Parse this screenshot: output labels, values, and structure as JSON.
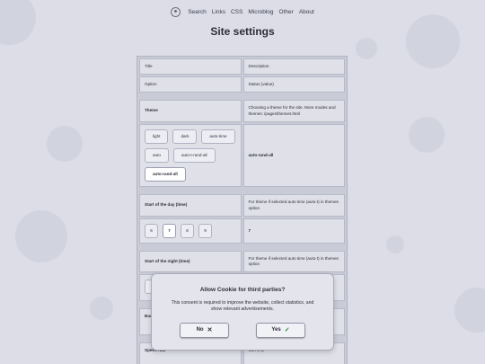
{
  "nav": {
    "items": [
      "Search",
      "Links",
      "CSS",
      "Microblog",
      "Other",
      "About"
    ]
  },
  "page": {
    "title": "Site settings"
  },
  "table": {
    "header": {
      "title": "Title",
      "description": "Description"
    },
    "header2": {
      "option": "Option",
      "status": "Status (value)"
    },
    "theme": {
      "label": "Theme",
      "description": "Choosing a theme for the site. More modes and themes: /pages/themes.html",
      "options": [
        "light",
        "dark",
        "auto-time",
        "auto",
        "auto-t-rand-all",
        "auto-rand-all"
      ],
      "selected": "auto-rand-all",
      "value": "auto-rand-all"
    },
    "day_start": {
      "label": "Start of the day (time)",
      "description": "For theme if selected auto time (auto-t) in themes option",
      "options": [
        "6",
        "7",
        "8",
        "9"
      ],
      "selected": "7",
      "value": "7"
    },
    "night_start": {
      "label": "Start of the night (time)",
      "description": "For theme if selected auto time (auto-t) in themes option"
    },
    "background": {
      "label": "Bac"
    },
    "speed": {
      "label": "Speed fbal",
      "description": "own link,"
    }
  },
  "cookie_dialog": {
    "title": "Allow Cookie for third parties?",
    "description": "This consent is required to improve the website, collect statistics, and show relevant advertisements.",
    "no_label": "No",
    "yes_label": "Yes"
  },
  "colors": {
    "background": "#dcdde6",
    "accent_check": "#1f8a3a"
  }
}
